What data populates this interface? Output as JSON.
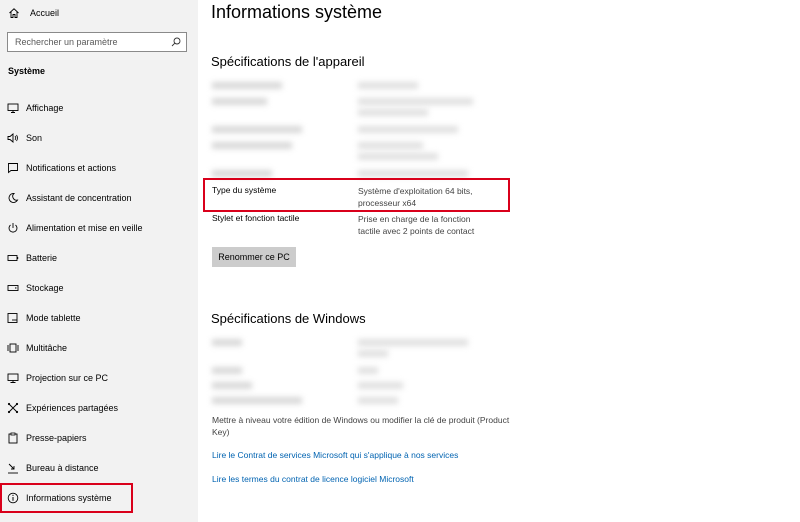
{
  "sidebar": {
    "home_label": "Accueil",
    "search_placeholder": "Rechercher un paramètre",
    "section_title": "Système",
    "items": [
      {
        "label": "Affichage",
        "icon": "display-icon"
      },
      {
        "label": "Son",
        "icon": "speaker-icon"
      },
      {
        "label": "Notifications et actions",
        "icon": "notification-icon"
      },
      {
        "label": "Assistant de concentration",
        "icon": "moon-icon"
      },
      {
        "label": "Alimentation et mise en veille",
        "icon": "power-icon"
      },
      {
        "label": "Batterie",
        "icon": "battery-icon"
      },
      {
        "label": "Stockage",
        "icon": "storage-icon"
      },
      {
        "label": "Mode tablette",
        "icon": "tablet-icon"
      },
      {
        "label": "Multitâche",
        "icon": "multitask-icon"
      },
      {
        "label": "Projection sur ce PC",
        "icon": "projection-icon"
      },
      {
        "label": "Expériences partagées",
        "icon": "shared-icon"
      },
      {
        "label": "Presse-papiers",
        "icon": "clipboard-icon"
      },
      {
        "label": "Bureau à distance",
        "icon": "remote-desktop-icon"
      },
      {
        "label": "Informations système",
        "icon": "info-icon"
      }
    ]
  },
  "main": {
    "title": "Informations système",
    "device_specs": {
      "heading": "Spécifications de l'appareil",
      "system_type_key": "Type du système",
      "system_type_value_1": "Système d'exploitation 64 bits,",
      "system_type_value_2": "processeur x64",
      "pen_touch_key": "Stylet et fonction tactile",
      "pen_touch_value_1": "Prise en charge de la fonction",
      "pen_touch_value_2": "tactile avec 2 points de contact",
      "rename_button": "Renommer ce PC"
    },
    "windows_specs": {
      "heading": "Spécifications de Windows",
      "upgrade_note": "Mettre à niveau votre édition de Windows ou modifier la clé de produit (Product Key)",
      "link_services": "Lire le Contrat de services Microsoft qui s'applique à nos services",
      "link_license": "Lire les termes du contrat de licence logiciel Microsoft"
    }
  },
  "colors": {
    "accent_link": "#0063b1",
    "highlight_red": "#d9001b",
    "sidebar_bg": "#f2f2f2"
  }
}
